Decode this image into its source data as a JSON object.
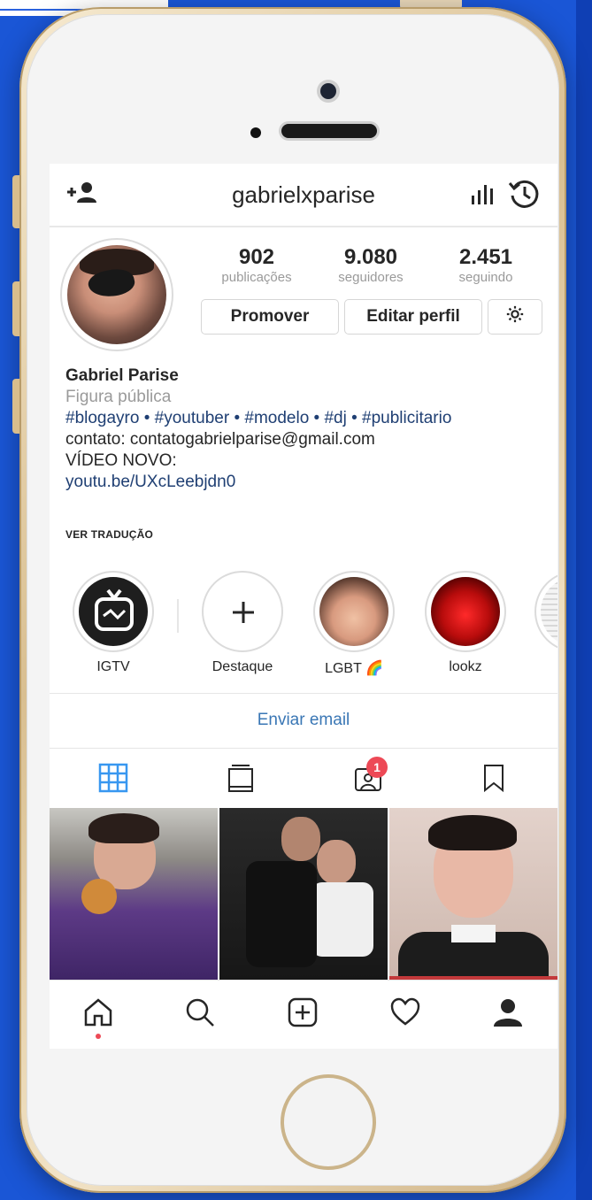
{
  "app": {
    "username": "gabrielxparise"
  },
  "profile": {
    "stats": [
      {
        "value": "902",
        "label": "publicações"
      },
      {
        "value": "9.080",
        "label": "seguidores"
      },
      {
        "value": "2.451",
        "label": "seguindo"
      }
    ],
    "buttons": {
      "promote": "Promover",
      "edit": "Editar perfil"
    },
    "bio": {
      "name": "Gabriel Parise",
      "category": "Figura pública",
      "hashtags": "#blogayro • #youtuber • #modelo • #dj • #publicitario",
      "contact": "contato: contatogabrielparise@gmail.com",
      "line": "VÍDEO NOVO:",
      "link": "youtu.be/UXcLeebjdn0"
    },
    "see_translation": "VER TRADUÇÃO"
  },
  "highlights": [
    {
      "label": "IGTV"
    },
    {
      "label": "Destaque"
    },
    {
      "label": "LGBT 🌈"
    },
    {
      "label": "lookz"
    }
  ],
  "actions": {
    "email": "Enviar email"
  },
  "tabs": {
    "tagged_badge": "1"
  },
  "icons": [
    "add-user-icon",
    "insights-icon",
    "archive-icon",
    "settings-gear-icon",
    "grid-icon",
    "igtv-tab-icon",
    "tagged-icon",
    "saved-icon",
    "home-icon",
    "search-icon",
    "new-post-icon",
    "activity-heart-icon",
    "profile-icon"
  ],
  "colors": {
    "link": "#1f3f73",
    "accent": "#3a77b5",
    "badge": "#ed4956",
    "grid_active": "#3897f0",
    "background": "#1a56d6"
  }
}
